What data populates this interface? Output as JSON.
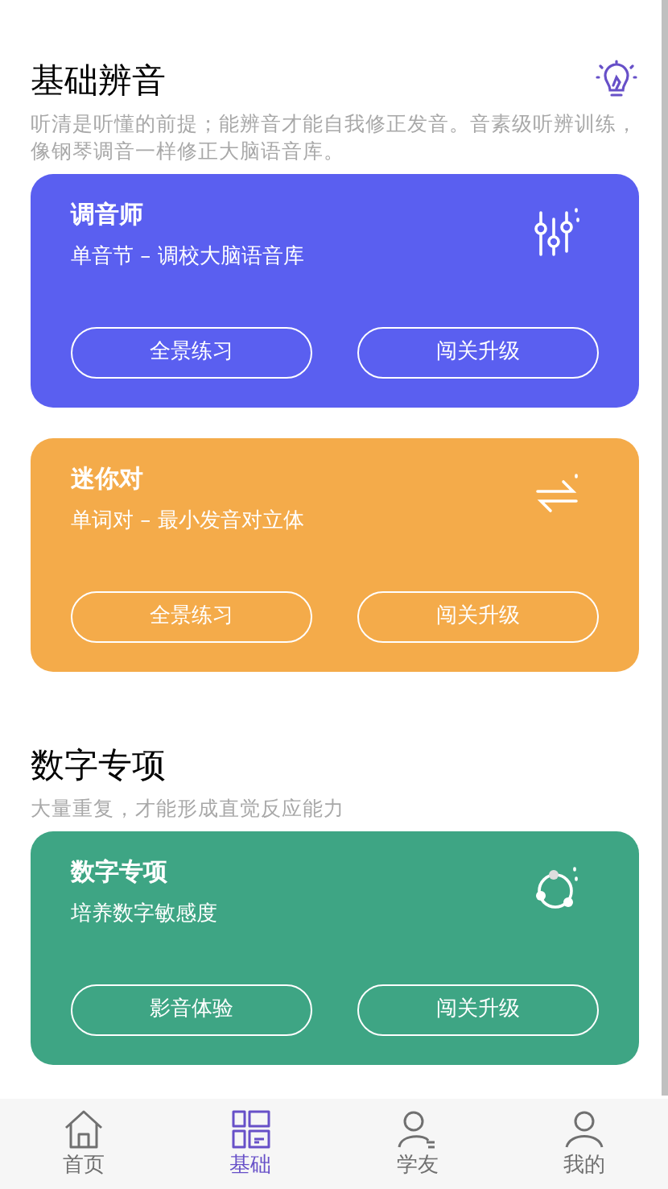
{
  "sections": [
    {
      "kind": "tip",
      "title": "基础辨音",
      "subtitle": "听清是听懂的前提；能辨音才能自我修正发音。音素级听辨训练，像钢琴调音一样修正大脑语音库。",
      "cards": [
        {
          "kind": "sliders",
          "color": "#5a5ff0",
          "title": "调音师",
          "subtitle": "单音节 – 调校大脑语音库",
          "buttons": [
            "全景练习",
            "闯关升级"
          ]
        },
        {
          "kind": "swap",
          "color": "#f4ab4a",
          "title": "迷你对",
          "subtitle": "单词对 – 最小发音对立体",
          "buttons": [
            "全景练习",
            "闯关升级"
          ]
        }
      ]
    },
    {
      "kind": "plain",
      "title": "数字专项",
      "subtitle": "大量重复，才能形成直觉反应能力",
      "cards": [
        {
          "kind": "cycle",
          "color": "#3ea584",
          "title": "数字专项",
          "subtitle": "培养数字敏感度",
          "buttons": [
            "影音体验",
            "闯关升级"
          ]
        }
      ]
    }
  ],
  "tab_bar": [
    {
      "kind": "home",
      "label": "首页",
      "selected": false
    },
    {
      "kind": "grid",
      "label": "基础",
      "selected": true
    },
    {
      "kind": "friends",
      "label": "学友",
      "selected": false
    },
    {
      "kind": "user",
      "label": "我的",
      "selected": false
    }
  ]
}
